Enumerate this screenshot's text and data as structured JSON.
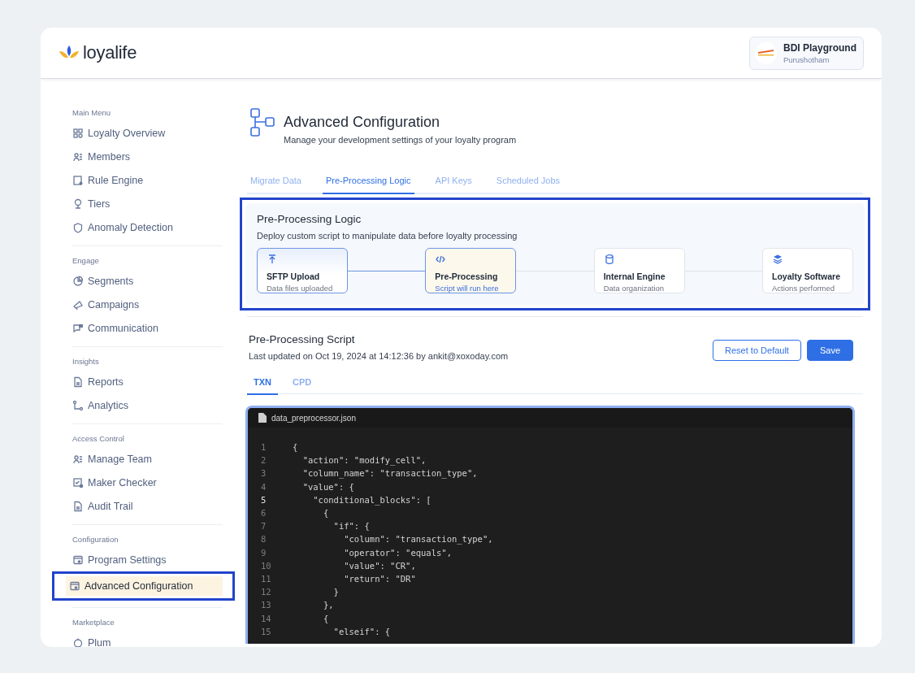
{
  "header": {
    "brand": "loyalife",
    "account": {
      "name": "BDI Playground",
      "user": "Purushotham"
    }
  },
  "sidebar": {
    "sections": [
      {
        "title": "Main Menu",
        "items": [
          {
            "label": "Loyalty Overview",
            "selected": false,
            "highlighted": false
          },
          {
            "label": "Members",
            "selected": false,
            "highlighted": false
          },
          {
            "label": "Rule Engine",
            "selected": false,
            "highlighted": false
          },
          {
            "label": "Tiers",
            "selected": false,
            "highlighted": false
          },
          {
            "label": "Anomaly Detection",
            "selected": false,
            "highlighted": false
          }
        ]
      },
      {
        "title": "Engage",
        "items": [
          {
            "label": "Segments",
            "selected": false,
            "highlighted": false
          },
          {
            "label": "Campaigns",
            "selected": false,
            "highlighted": false
          },
          {
            "label": "Communication",
            "selected": false,
            "highlighted": false
          }
        ]
      },
      {
        "title": "Insights",
        "items": [
          {
            "label": "Reports",
            "selected": false,
            "highlighted": false
          },
          {
            "label": "Analytics",
            "selected": false,
            "highlighted": false
          }
        ]
      },
      {
        "title": "Access Control",
        "items": [
          {
            "label": "Manage Team",
            "selected": false,
            "highlighted": false
          },
          {
            "label": "Maker Checker",
            "selected": false,
            "highlighted": false
          },
          {
            "label": "Audit Trail",
            "selected": false,
            "highlighted": false
          }
        ]
      },
      {
        "title": "Configuration",
        "items": [
          {
            "label": "Program Settings",
            "selected": false,
            "highlighted": false
          },
          {
            "label": "Advanced Configuration",
            "selected": true,
            "highlighted": true
          }
        ]
      },
      {
        "title": "Marketplace",
        "items": [
          {
            "label": "Plum",
            "selected": false,
            "highlighted": false
          }
        ]
      }
    ]
  },
  "page": {
    "title": "Advanced Configuration",
    "subtitle": "Manage your development settings of your loyalty program"
  },
  "tabs": [
    {
      "label": "Migrate Data",
      "selected": false
    },
    {
      "label": "Pre-Processing Logic",
      "selected": true
    },
    {
      "label": "API Keys",
      "selected": false
    },
    {
      "label": "Scheduled Jobs",
      "selected": false
    }
  ],
  "pipeline": {
    "title": "Pre-Processing Logic",
    "description": "Deploy custom script to manipulate data before loyalty processing",
    "highlighted": true,
    "steps": [
      {
        "title": "SFTP Upload",
        "caption": "Data files uploaded",
        "kind": "done"
      },
      {
        "title": "Pre-Processing",
        "caption": "Script will run here",
        "kind": "active"
      },
      {
        "title": "Internal Engine",
        "caption": "Data organization",
        "kind": "pending"
      },
      {
        "title": "Loyalty Software",
        "caption": "Actions performed",
        "kind": "pending"
      }
    ]
  },
  "script": {
    "title": "Pre-Processing Script",
    "updated": "Last updated on Oct 19, 2024 at 14:12:36 by ankit@xoxoday.com",
    "buttons": [
      {
        "label": "Reset to Default",
        "kind": "outline"
      },
      {
        "label": "Save",
        "kind": "primary"
      }
    ],
    "tabs": [
      {
        "label": "TXN",
        "selected": true
      },
      {
        "label": "CPD",
        "selected": false
      }
    ],
    "file": "data_preprocessor.json",
    "lines": [
      {
        "number": "1",
        "text": "{",
        "current": false
      },
      {
        "number": "2",
        "text": "  \"action\": \"modify_cell\",",
        "current": false
      },
      {
        "number": "3",
        "text": "  \"column_name\": \"transaction_type\",",
        "current": false
      },
      {
        "number": "4",
        "text": "  \"value\": {",
        "current": false
      },
      {
        "number": "5",
        "text": "    \"conditional_blocks\": [",
        "current": true
      },
      {
        "number": "6",
        "text": "      {",
        "current": false
      },
      {
        "number": "7",
        "text": "        \"if\": {",
        "current": false
      },
      {
        "number": "8",
        "text": "          \"column\": \"transaction_type\",",
        "current": false
      },
      {
        "number": "9",
        "text": "          \"operator\": \"equals\",",
        "current": false
      },
      {
        "number": "10",
        "text": "          \"value\": \"CR\",",
        "current": false
      },
      {
        "number": "11",
        "text": "          \"return\": \"DR\"",
        "current": false
      },
      {
        "number": "12",
        "text": "        }",
        "current": false
      },
      {
        "number": "13",
        "text": "      },",
        "current": false
      },
      {
        "number": "14",
        "text": "      {",
        "current": false
      },
      {
        "number": "15",
        "text": "        \"elseif\": {",
        "current": false
      }
    ]
  }
}
